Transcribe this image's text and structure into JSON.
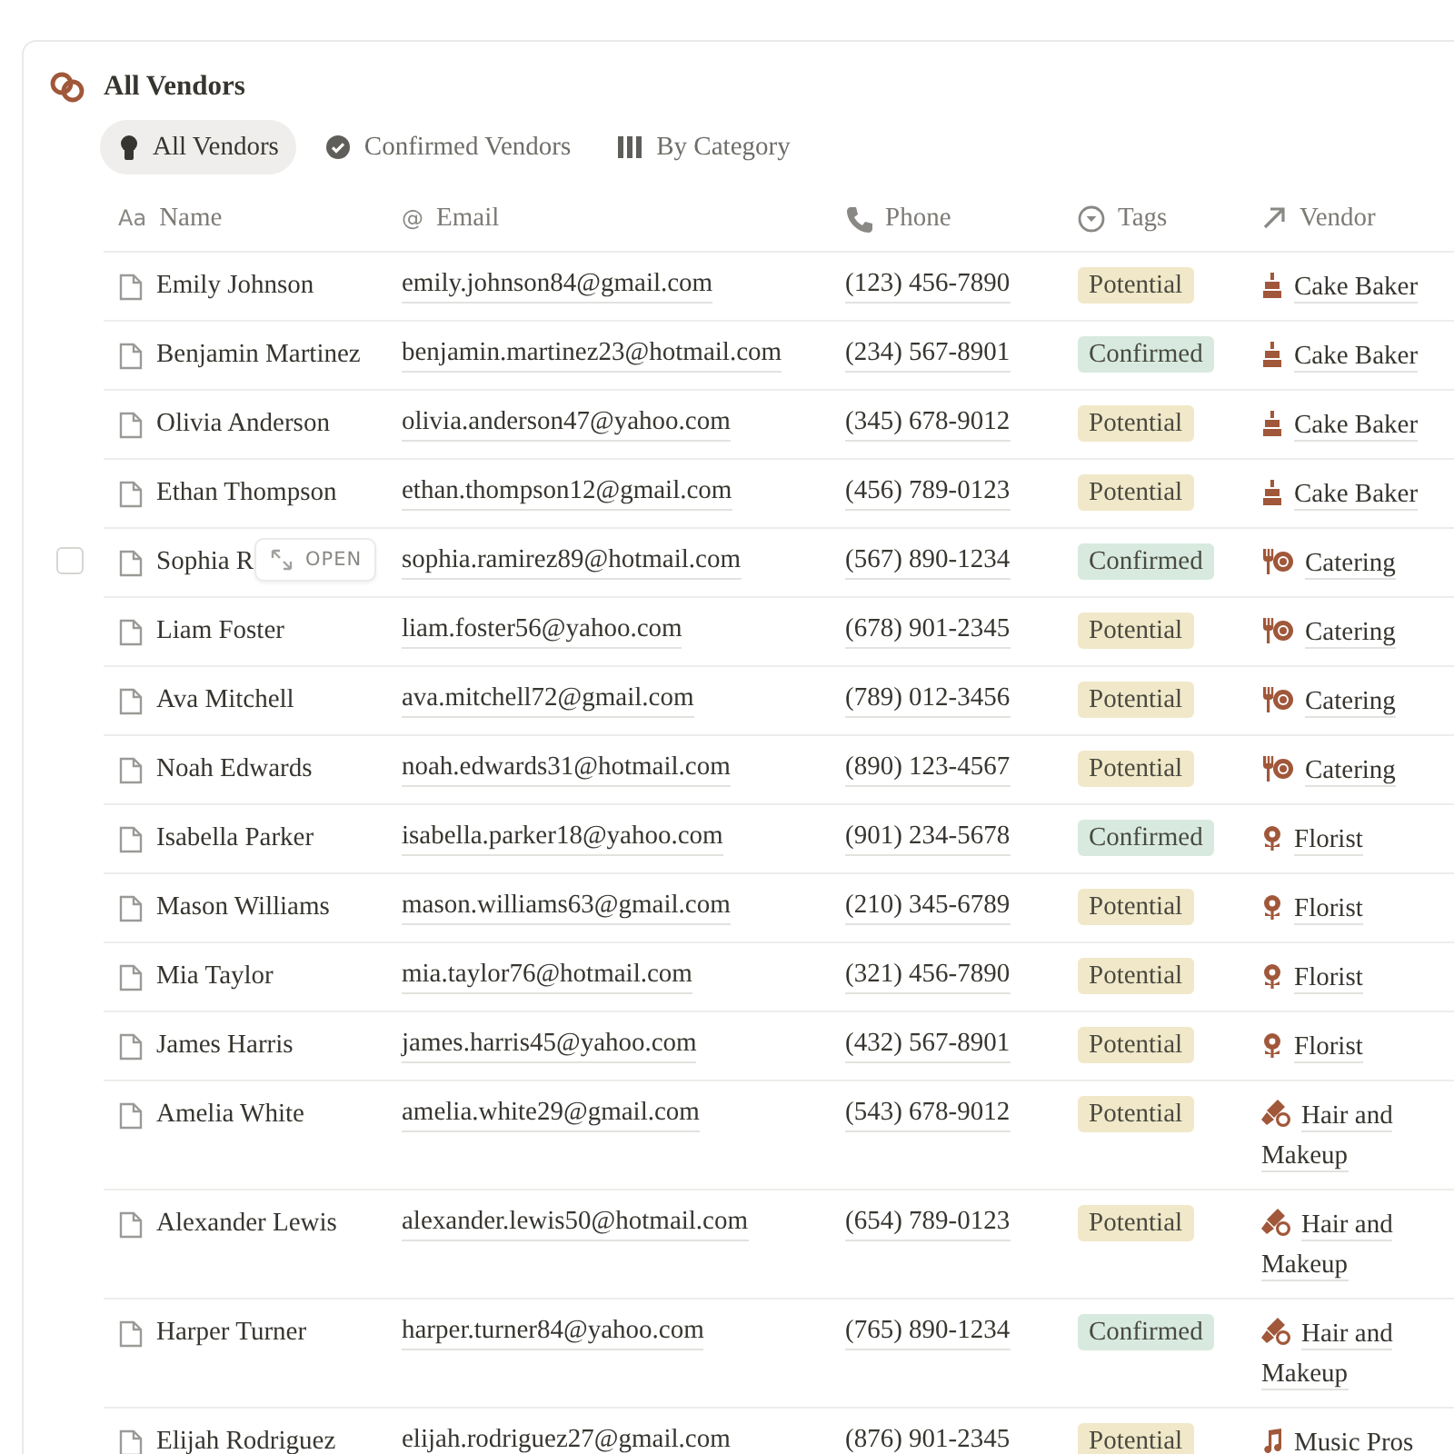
{
  "database": {
    "title": "All Vendors"
  },
  "views": [
    {
      "label": "All Vendors",
      "kind": "person",
      "selected": true
    },
    {
      "label": "Confirmed Vendors",
      "kind": "check",
      "selected": false
    },
    {
      "label": "By Category",
      "kind": "board",
      "selected": false
    }
  ],
  "columns": [
    {
      "label": "Name",
      "kind": "title",
      "icon": "Aa"
    },
    {
      "label": "Email",
      "kind": "email",
      "icon": "@"
    },
    {
      "label": "Phone",
      "kind": "phone"
    },
    {
      "label": "Tags",
      "kind": "select"
    },
    {
      "label": "Vendor",
      "kind": "relation"
    }
  ],
  "open_button": {
    "label": "OPEN"
  },
  "rows": [
    {
      "name": "Emily Johnson",
      "email": "emily.johnson84@gmail.com",
      "phone": "(123) 456-7890",
      "tag": {
        "label": "Potential",
        "color": "#f1e8c9"
      },
      "vendor": {
        "label": "Cake Baker",
        "kind": "cake"
      },
      "hovered": false
    },
    {
      "name": "Benjamin Martinez",
      "email": "benjamin.martinez23@hotmail.com",
      "phone": "(234) 567-8901",
      "tag": {
        "label": "Confirmed",
        "color": "#d8eadf"
      },
      "vendor": {
        "label": "Cake Baker",
        "kind": "cake"
      },
      "hovered": false
    },
    {
      "name": "Olivia Anderson",
      "email": "olivia.anderson47@yahoo.com",
      "phone": "(345) 678-9012",
      "tag": {
        "label": "Potential",
        "color": "#f1e8c9"
      },
      "vendor": {
        "label": "Cake Baker",
        "kind": "cake"
      },
      "hovered": false
    },
    {
      "name": "Ethan Thompson",
      "email": "ethan.thompson12@gmail.com",
      "phone": "(456) 789-0123",
      "tag": {
        "label": "Potential",
        "color": "#f1e8c9"
      },
      "vendor": {
        "label": "Cake Baker",
        "kind": "cake"
      },
      "hovered": false
    },
    {
      "name": "Sophia R",
      "email": "sophia.ramirez89@hotmail.com",
      "phone": "(567) 890-1234",
      "tag": {
        "label": "Confirmed",
        "color": "#d8eadf"
      },
      "vendor": {
        "label": "Catering",
        "kind": "catering"
      },
      "hovered": true
    },
    {
      "name": "Liam Foster",
      "email": "liam.foster56@yahoo.com",
      "phone": "(678) 901-2345",
      "tag": {
        "label": "Potential",
        "color": "#f1e8c9"
      },
      "vendor": {
        "label": "Catering",
        "kind": "catering"
      },
      "hovered": false
    },
    {
      "name": "Ava Mitchell",
      "email": "ava.mitchell72@gmail.com",
      "phone": "(789) 012-3456",
      "tag": {
        "label": "Potential",
        "color": "#f1e8c9"
      },
      "vendor": {
        "label": "Catering",
        "kind": "catering"
      },
      "hovered": false
    },
    {
      "name": "Noah Edwards",
      "email": "noah.edwards31@hotmail.com",
      "phone": "(890) 123-4567",
      "tag": {
        "label": "Potential",
        "color": "#f1e8c9"
      },
      "vendor": {
        "label": "Catering",
        "kind": "catering"
      },
      "hovered": false
    },
    {
      "name": "Isabella Parker",
      "email": "isabella.parker18@yahoo.com",
      "phone": "(901) 234-5678",
      "tag": {
        "label": "Confirmed",
        "color": "#d8eadf"
      },
      "vendor": {
        "label": "Florist",
        "kind": "flower"
      },
      "hovered": false
    },
    {
      "name": "Mason Williams",
      "email": "mason.williams63@gmail.com",
      "phone": "(210) 345-6789",
      "tag": {
        "label": "Potential",
        "color": "#f1e8c9"
      },
      "vendor": {
        "label": "Florist",
        "kind": "flower"
      },
      "hovered": false
    },
    {
      "name": "Mia Taylor",
      "email": "mia.taylor76@hotmail.com",
      "phone": "(321) 456-7890",
      "tag": {
        "label": "Potential",
        "color": "#f1e8c9"
      },
      "vendor": {
        "label": "Florist",
        "kind": "flower"
      },
      "hovered": false
    },
    {
      "name": "James Harris",
      "email": "james.harris45@yahoo.com",
      "phone": "(432) 567-8901",
      "tag": {
        "label": "Potential",
        "color": "#f1e8c9"
      },
      "vendor": {
        "label": "Florist",
        "kind": "flower"
      },
      "hovered": false
    },
    {
      "name": "Amelia White",
      "email": "amelia.white29@gmail.com",
      "phone": "(543) 678-9012",
      "tag": {
        "label": "Potential",
        "color": "#f1e8c9"
      },
      "vendor": {
        "label": "Hair and Makeup",
        "kind": "makeup"
      },
      "hovered": false
    },
    {
      "name": "Alexander Lewis",
      "email": "alexander.lewis50@hotmail.com",
      "phone": "(654) 789-0123",
      "tag": {
        "label": "Potential",
        "color": "#f1e8c9"
      },
      "vendor": {
        "label": "Hair and Makeup",
        "kind": "makeup"
      },
      "hovered": false
    },
    {
      "name": "Harper Turner",
      "email": "harper.turner84@yahoo.com",
      "phone": "(765) 890-1234",
      "tag": {
        "label": "Confirmed",
        "color": "#d8eadf"
      },
      "vendor": {
        "label": "Hair and Makeup",
        "kind": "makeup"
      },
      "hovered": false
    },
    {
      "name": "Elijah Rodriguez",
      "email": "elijah.rodriguez27@gmail.com",
      "phone": "(876) 901-2345",
      "tag": {
        "label": "Potential",
        "color": "#f1e8c9"
      },
      "vendor": {
        "label": "Music Pros",
        "kind": "music"
      },
      "hovered": false
    }
  ]
}
